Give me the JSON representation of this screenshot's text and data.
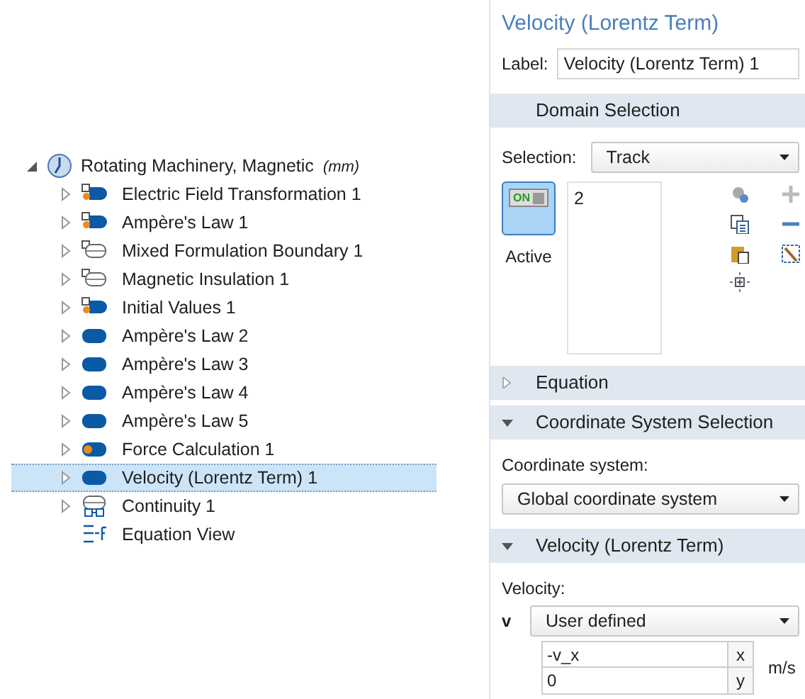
{
  "tree": {
    "label": "Rotating Machinery, Magnetic",
    "unit": "(mm)",
    "expanded": true,
    "children": [
      {
        "label": "Electric Field Transformation 1",
        "kind": "mixed",
        "selected": false
      },
      {
        "label": "Ampère's Law 1",
        "kind": "mixed",
        "selected": false
      },
      {
        "label": "Mixed Formulation Boundary 1",
        "kind": "boundary",
        "selected": false
      },
      {
        "label": "Magnetic Insulation 1",
        "kind": "boundary",
        "selected": false
      },
      {
        "label": "Initial Values 1",
        "kind": "mixed",
        "selected": false
      },
      {
        "label": "Ampère's Law 2",
        "kind": "domain",
        "selected": false
      },
      {
        "label": "Ampère's Law 3",
        "kind": "domain",
        "selected": false
      },
      {
        "label": "Ampère's Law 4",
        "kind": "domain",
        "selected": false
      },
      {
        "label": "Ampère's Law 5",
        "kind": "domain",
        "selected": false
      },
      {
        "label": "Force Calculation 1",
        "kind": "force",
        "selected": false
      },
      {
        "label": "Velocity (Lorentz Term) 1",
        "kind": "domain",
        "selected": true
      },
      {
        "label": "Continuity 1",
        "kind": "continuity",
        "selected": false
      },
      {
        "label": "Equation View",
        "kind": "equation",
        "selected": false
      }
    ]
  },
  "settings": {
    "title": "Velocity (Lorentz Term)",
    "label_caption": "Label:",
    "label_value": "Velocity (Lorentz Term) 1",
    "domain_selection": {
      "header": "Domain Selection",
      "selection_caption": "Selection:",
      "selection_value": "Track",
      "active_label": "Active",
      "active_switch": "ON",
      "active": true,
      "entities": [
        "2"
      ]
    },
    "equation": {
      "header": "Equation",
      "expanded": false
    },
    "coordinate_system": {
      "header": "Coordinate System Selection",
      "expanded": true,
      "caption": "Coordinate system:",
      "value": "Global coordinate system"
    },
    "velocity": {
      "header": "Velocity (Lorentz Term)",
      "expanded": true,
      "caption": "Velocity:",
      "symbol": "v",
      "mode": "User defined",
      "unit": "m/s",
      "components": [
        {
          "value": "-v_x",
          "axis": "x"
        },
        {
          "value": "0",
          "axis": "y"
        }
      ]
    }
  }
}
